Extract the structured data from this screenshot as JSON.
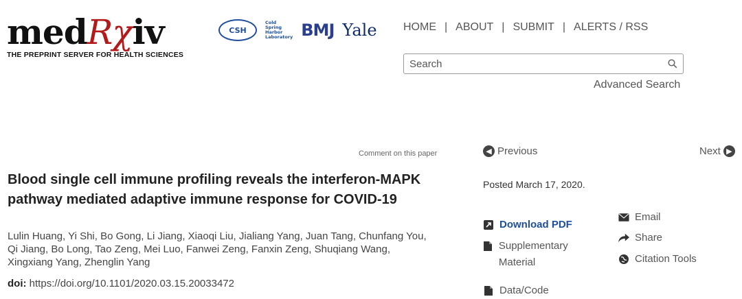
{
  "logo": {
    "word_prefix": "med",
    "word_rx": "Rχ",
    "word_suffix": "iv",
    "tagline": "THE PREPRINT SERVER FOR HEALTH SCIENCES"
  },
  "partners": {
    "csh": "CSH",
    "csh_words": [
      "Cold",
      "Spring",
      "Harbor",
      "Laboratory"
    ],
    "bmj": "BMJ",
    "yale": "Yale"
  },
  "nav": {
    "home": "HOME",
    "about": "ABOUT",
    "submit": "SUBMIT",
    "alerts": "ALERTS / RSS",
    "sep": "|"
  },
  "search": {
    "placeholder": "Search",
    "advanced": "Advanced Search"
  },
  "article": {
    "comment": "Comment on this paper",
    "title": "Blood single cell immune profiling reveals the interferon-MAPK pathway mediated adaptive immune response for COVID-19",
    "authors": "Lulin Huang, Yi Shi, Bo Gong, Li Jiang, Xiaoqi Liu, Jialiang Yang, Juan Tang, Chunfang You, Qi Jiang, Bo Long, Tao Zeng, Mei Luo, Fanwei Zeng, Fanxin Zeng, Shuqiang Wang, Xingxiang Yang, Zhenglin Yang",
    "doi_label": "doi:",
    "doi_value": "https://doi.org/10.1101/2020.03.15.20033472"
  },
  "sidebar": {
    "previous": "Previous",
    "next": "Next",
    "posted": "Posted March 17, 2020.",
    "download_pdf": "Download PDF",
    "supplementary": "Supplementary Material",
    "data_code": "Data/Code",
    "email": "Email",
    "share": "Share",
    "citation_tools": "Citation Tools"
  },
  "colors": {
    "brand_red": "#b31b1b",
    "link_blue": "#1f4f9c"
  },
  "icons": {
    "search": "magnifier-icon",
    "prev": "arrow-left-circle-icon",
    "next": "arrow-right-circle-icon",
    "pdf": "pdf-icon",
    "file": "file-icon",
    "email": "envelope-icon",
    "share": "share-arrow-icon",
    "cite": "globe-icon"
  }
}
